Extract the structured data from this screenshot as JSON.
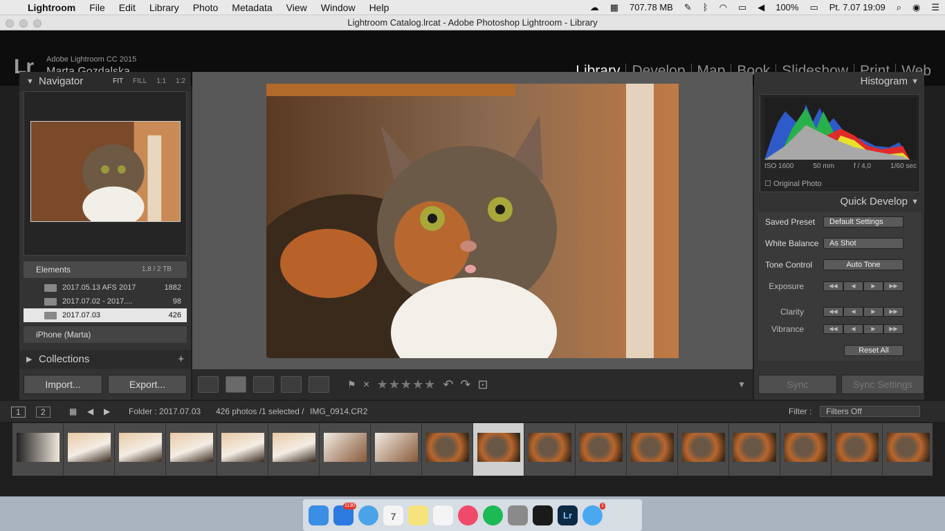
{
  "menubar": {
    "app": "Lightroom",
    "items": [
      "File",
      "Edit",
      "Library",
      "Photo",
      "Metadata",
      "View",
      "Window",
      "Help"
    ],
    "memory": "707.78 MB",
    "battery": "100%",
    "clock": "Pt. 7.07  19:09"
  },
  "window": {
    "title": "Lightroom Catalog.lrcat - Adobe Photoshop Lightroom - Library"
  },
  "identity": {
    "logo": "Lr",
    "app_name": "Adobe Lightroom CC 2015",
    "user_name": "Marta Gozdalska",
    "modules": [
      "Library",
      "Develop",
      "Map",
      "Book",
      "Slideshow",
      "Print",
      "Web"
    ],
    "active_module": "Library"
  },
  "navigator": {
    "title": "Navigator",
    "zoom": [
      "FIT",
      "FILL",
      "1:1",
      "1:2"
    ]
  },
  "folders": {
    "volume": {
      "name": "Elements",
      "capacity": "1,8 / 2 TB"
    },
    "items": [
      {
        "name": "2017.05.13 AFS 2017",
        "count": "1882"
      },
      {
        "name": "2017.07.02 - 2017....",
        "count": "98"
      },
      {
        "name": "2017.07.03",
        "count": "426"
      }
    ],
    "device": "iPhone (Marta)"
  },
  "collections": {
    "title": "Collections"
  },
  "left_buttons": {
    "import": "Import...",
    "export": "Export..."
  },
  "histogram": {
    "title": "Histogram",
    "iso": "ISO 1600",
    "focal": "50 mm",
    "aperture": "f / 4,0",
    "shutter": "1/60 sec",
    "original": "Original Photo"
  },
  "quick_develop": {
    "title": "Quick Develop",
    "saved_preset_label": "Saved Preset",
    "saved_preset_value": "Default Settings",
    "white_balance_label": "White Balance",
    "white_balance_value": "As Shot",
    "tone_control_label": "Tone Control",
    "auto_tone": "Auto Tone",
    "exposure": "Exposure",
    "clarity": "Clarity",
    "vibrance": "Vibrance",
    "reset_all": "Reset All"
  },
  "sync": {
    "sync": "Sync",
    "sync_settings": "Sync Settings"
  },
  "filmstrip_bar": {
    "page1": "1",
    "page2": "2",
    "folder": "Folder : 2017.07.03",
    "count": "426 photos /1 selected /",
    "filename": "IMG_0914.CR2",
    "filter_label": "Filter :",
    "filter_value": "Filters Off"
  },
  "dock": {
    "mail_badge": "1130",
    "calendar_day": "7",
    "messages_badge": "1"
  }
}
